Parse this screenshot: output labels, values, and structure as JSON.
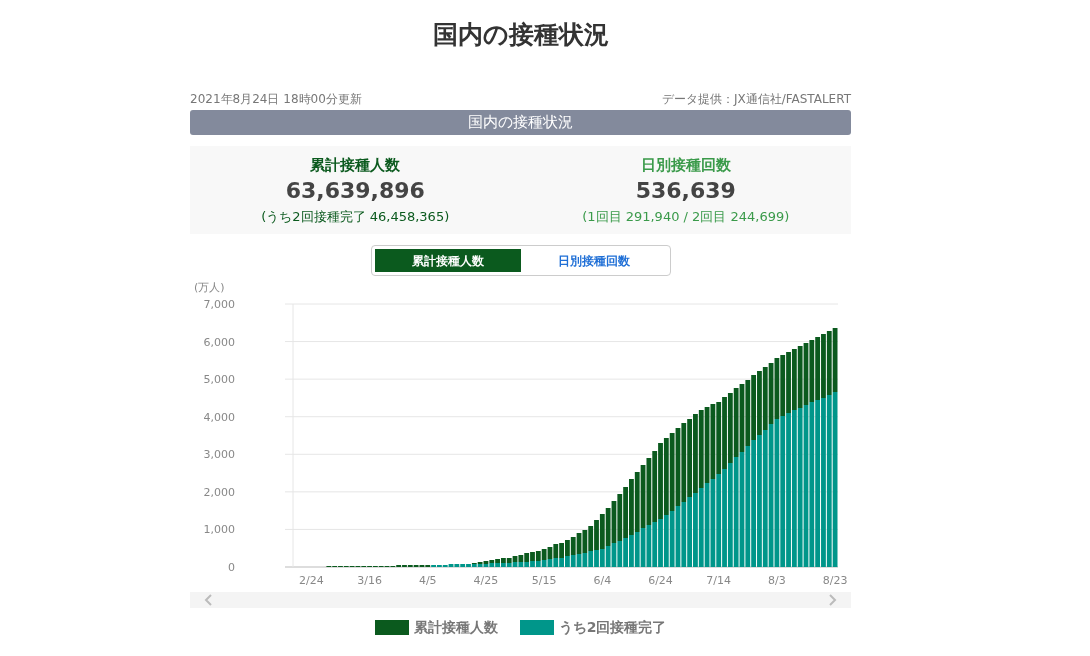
{
  "page_title": "国内の接種状況",
  "updated": "2021年8月24日 18時00分更新",
  "source": "データ提供：JX通信社/FASTALERT",
  "banner": "国内の接種状況",
  "stats": [
    {
      "label": "累計接種人数",
      "value": "63,639,896",
      "note": "(うち2回接種完了 46,458,365)",
      "color": "#0b5a1e"
    },
    {
      "label": "日別接種回数",
      "value": "536,639",
      "note": "(1回目 291,940 / 2回目 244,699)",
      "color": "#3a9a4a"
    }
  ],
  "toggle": [
    {
      "label": "累計接種人数",
      "selected": true
    },
    {
      "label": "日別接種回数",
      "selected": false
    }
  ],
  "unit": "(万人)",
  "chart_data": {
    "type": "bar",
    "stacked": true,
    "categories": [
      null,
      null,
      null,
      "2/24",
      null,
      null,
      null,
      null,
      null,
      null,
      null,
      null,
      null,
      "3/16",
      null,
      null,
      null,
      null,
      null,
      null,
      null,
      null,
      null,
      "4/5",
      null,
      null,
      null,
      null,
      null,
      null,
      null,
      null,
      null,
      "4/25",
      null,
      null,
      null,
      null,
      null,
      null,
      null,
      null,
      null,
      "5/15",
      null,
      null,
      null,
      null,
      null,
      null,
      null,
      null,
      null,
      "6/4",
      null,
      null,
      null,
      null,
      null,
      null,
      null,
      null,
      null,
      "6/24",
      null,
      null,
      null,
      null,
      null,
      null,
      null,
      null,
      null,
      "7/14",
      null,
      null,
      null,
      null,
      null,
      null,
      null,
      null,
      null,
      "8/3",
      null,
      null,
      null,
      null,
      null,
      null,
      null,
      null,
      null,
      "8/23"
    ],
    "series": [
      {
        "name": "累計接種人数",
        "color": "#0b5a1e",
        "values": [
          0,
          0,
          0,
          0,
          0,
          0,
          10,
          10,
          10,
          10,
          10,
          10,
          10,
          10,
          20,
          30,
          30,
          30,
          40,
          40,
          40,
          50,
          40,
          50,
          0,
          0,
          0,
          0,
          0,
          0,
          0,
          30,
          40,
          70,
          90,
          100,
          120,
          140,
          160,
          180,
          220,
          250,
          270,
          300,
          330,
          370,
          400,
          440,
          490,
          550,
          610,
          680,
          790,
          910,
          1020,
          1130,
          1250,
          1360,
          1470,
          1580,
          1680,
          1790,
          1910,
          2020,
          2040,
          2060,
          2070,
          2080,
          2080,
          2080,
          2070,
          2030,
          1990,
          1930,
          1900,
          1870,
          1840,
          1810,
          1770,
          1730,
          1710,
          1680,
          1640,
          1610,
          1620,
          1620,
          1630,
          1640,
          1650,
          1660,
          1680,
          1700,
          1710,
          1720
        ]
      },
      {
        "name": "うち2回接種完了",
        "color": "#00968a",
        "values": [
          0,
          0,
          0,
          0,
          0,
          0,
          0,
          0,
          0,
          0,
          0,
          0,
          0,
          0,
          0,
          0,
          0,
          0,
          0,
          0,
          0,
          0,
          0,
          0,
          50,
          60,
          60,
          70,
          70,
          80,
          90,
          80,
          80,
          90,
          100,
          100,
          110,
          110,
          120,
          130,
          140,
          150,
          160,
          180,
          200,
          230,
          250,
          280,
          310,
          350,
          380,
          420,
          460,
          490,
          560,
          630,
          700,
          780,
          860,
          940,
          1030,
          1110,
          1190,
          1280,
          1390,
          1500,
          1620,
          1740,
          1860,
          1980,
          2100,
          2230,
          2350,
          2470,
          2620,
          2770,
          2920,
          3070,
          3220,
          3370,
          3510,
          3650,
          3800,
          3940,
          4020,
          4100,
          4170,
          4240,
          4310,
          4380,
          4440,
          4500,
          4570,
          4650
        ]
      }
    ],
    "ylim": [
      0,
      7000
    ],
    "grid": true,
    "yticks": [
      {
        "value": 0,
        "label": "0"
      },
      {
        "value": 1000,
        "label": "1,000"
      },
      {
        "value": 2000,
        "label": "2,000"
      },
      {
        "value": 3000,
        "label": "3,000"
      },
      {
        "value": 4000,
        "label": "4,000"
      },
      {
        "value": 5000,
        "label": "5,000"
      },
      {
        "value": 6000,
        "label": "6,000"
      },
      {
        "value": 7000,
        "label": "7,000"
      }
    ]
  }
}
